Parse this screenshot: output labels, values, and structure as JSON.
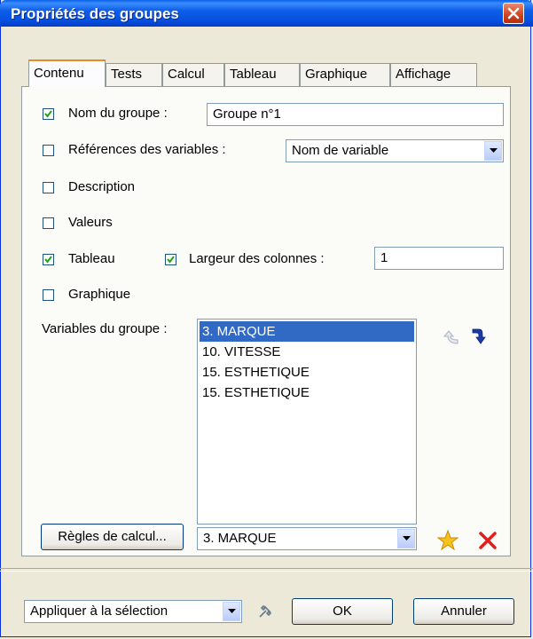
{
  "window": {
    "title": "Propriétés des groupes"
  },
  "tabs": [
    {
      "label": "Contenu",
      "active": true
    },
    {
      "label": "Tests"
    },
    {
      "label": "Calcul"
    },
    {
      "label": "Tableau"
    },
    {
      "label": "Graphique"
    },
    {
      "label": "Affichage"
    }
  ],
  "content": {
    "group_name": {
      "label": "Nom du groupe :",
      "checked": true,
      "value": "Groupe n°1"
    },
    "var_refs": {
      "label": "Références des variables :",
      "checked": false,
      "selected": "Nom de variable"
    },
    "description": {
      "label": "Description",
      "checked": false
    },
    "values": {
      "label": "Valeurs",
      "checked": false
    },
    "table": {
      "label": "Tableau",
      "checked": true
    },
    "col_width": {
      "label": "Largeur des colonnes :",
      "checked": true,
      "value": "1"
    },
    "chart": {
      "label": "Graphique",
      "checked": false
    },
    "group_vars": {
      "label": "Variables du groupe :",
      "items": [
        "3. MARQUE",
        "10. VITESSE",
        "15. ESTHETIQUE",
        "15. ESTHETIQUE"
      ],
      "selected_index": 0
    },
    "calc_rules": {
      "button_label": "Règles de calcul...",
      "selected": "3. MARQUE"
    }
  },
  "footer": {
    "apply_scope": "Appliquer à la sélection",
    "ok_label": "OK",
    "cancel_label": "Annuler"
  },
  "icons": {
    "move_up": "arrow-up-icon",
    "move_down": "arrow-down-icon",
    "favorite": "star-icon",
    "delete": "delete-x-icon",
    "tools": "tools-icon"
  },
  "colors": {
    "titlebar": "#0a5fe8",
    "selection": "#316ac5",
    "active_tab_accent": "#e68b2c",
    "delete": "#e0201b"
  }
}
